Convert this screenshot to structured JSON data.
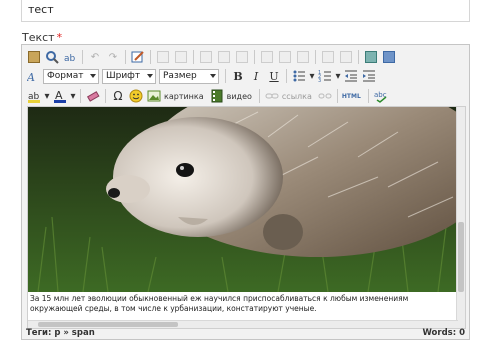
{
  "title_field": {
    "value": "тест"
  },
  "text_field": {
    "label": "Текст",
    "required_mark": "*"
  },
  "toolbar": {
    "format_label": "Формат",
    "font_label": "Шрифт",
    "size_label": "Размер",
    "bold_label": "B",
    "italic_label": "I",
    "underline_label": "U",
    "omega_label": "Ω",
    "image_label": "картинка",
    "video_label": "видео",
    "link_label": "ссылка",
    "html_label": "HTML"
  },
  "content": {
    "caption": "За 15 млн лет эволюции обыкновенный еж научился приспосабливаться к любым изменениям окружающей среды, в том числе к урбанизации, констатируют ученые."
  },
  "status": {
    "path": "Теги: p » span",
    "words": "Words: 0"
  },
  "colors": {
    "required": "#e02020",
    "editor_bg": "#f2f2f2"
  }
}
